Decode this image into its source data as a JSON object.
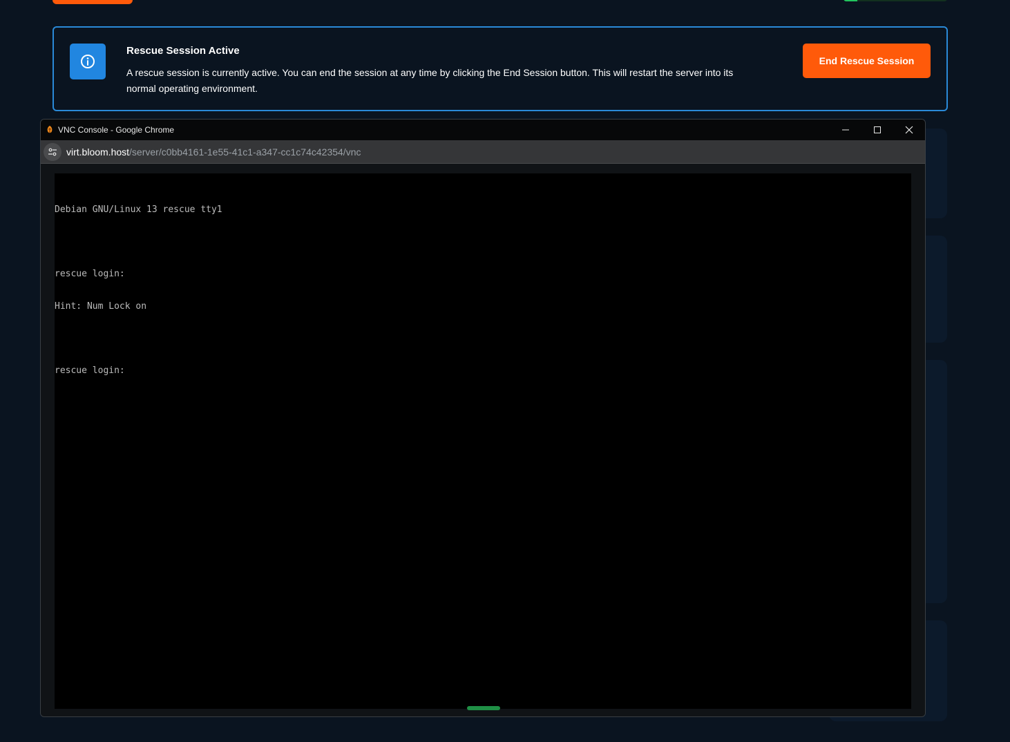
{
  "banner": {
    "title": "Rescue Session Active",
    "text": "A rescue session is currently active. You can end the session at any time by clicking the End Session button. This will restart the server into its normal operating environment.",
    "button_label": "End Rescue Session",
    "icon": "info-icon"
  },
  "chrome_window": {
    "title": "VNC Console - Google Chrome",
    "url_host": "virt.bloom.host",
    "url_path": "/server/c0bb4161-1e55-41c1-a347-cc1c74c42354/vnc"
  },
  "terminal": {
    "lines": [
      "Debian GNU/Linux 13 rescue tty1",
      "",
      "rescue login:",
      "Hint: Num Lock on",
      "",
      "rescue login:"
    ]
  },
  "colors": {
    "accent_orange": "#ff5a0a",
    "info_blue": "#2186e0",
    "banner_border": "#2a8ad8",
    "page_bg": "#0a1420"
  }
}
